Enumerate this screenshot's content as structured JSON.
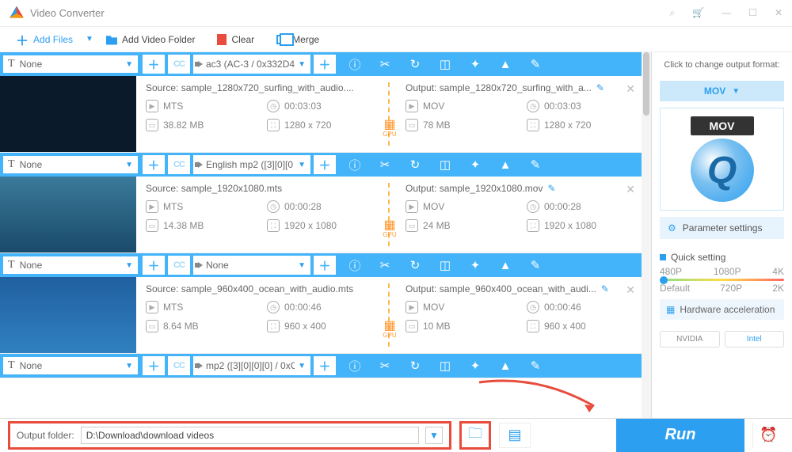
{
  "app": {
    "title": "Video Converter"
  },
  "toolbar": {
    "add": "Add Files",
    "folder": "Add Video Folder",
    "clear": "Clear",
    "merge": "Merge"
  },
  "items": [
    {
      "subtitle": "None",
      "audio": "ac3 (AC-3 / 0x332D4",
      "source": "Source: sample_1280x720_surfing_with_audio....",
      "src_fmt": "MTS",
      "src_dur": "00:03:03",
      "src_size": "38.82 MB",
      "src_res": "1280 x 720",
      "output": "Output: sample_1280x720_surfing_with_a...",
      "out_fmt": "MOV",
      "out_dur": "00:03:03",
      "out_size": "78 MB",
      "out_res": "1280 x 720",
      "gpu": "GPU"
    },
    {
      "subtitle": "None",
      "audio": "English mp2 ([3][0][0",
      "source": "Source: sample_1920x1080.mts",
      "src_fmt": "MTS",
      "src_dur": "00:00:28",
      "src_size": "14.38 MB",
      "src_res": "1920 x 1080",
      "output": "Output: sample_1920x1080.mov",
      "out_fmt": "MOV",
      "out_dur": "00:00:28",
      "out_size": "24 MB",
      "out_res": "1920 x 1080",
      "gpu": "GPU"
    },
    {
      "subtitle": "None",
      "audio": "None",
      "source": "Source: sample_960x400_ocean_with_audio.mts",
      "src_fmt": "MTS",
      "src_dur": "00:00:46",
      "src_size": "8.64 MB",
      "src_res": "960 x 400",
      "output": "Output: sample_960x400_ocean_with_audi...",
      "out_fmt": "MOV",
      "out_dur": "00:00:46",
      "out_size": "10 MB",
      "out_res": "960 x 400",
      "gpu": "GPU"
    },
    {
      "subtitle": "None",
      "audio": " mp2 ([3][0][0][0] / 0xC"
    }
  ],
  "right": {
    "label": "Click to change output format:",
    "format": "MOV",
    "badge": "MOV",
    "param": "Parameter settings",
    "quick": "Quick setting",
    "ticks_top": [
      "480P",
      "1080P",
      "4K"
    ],
    "ticks_bottom": [
      "Default",
      "720P",
      "2K"
    ],
    "hw": "Hardware acceleration",
    "nvidia": "NVIDIA",
    "intel": "Intel"
  },
  "footer": {
    "label": "Output folder:",
    "path": "D:\\Download\\download videos",
    "run": "Run"
  }
}
